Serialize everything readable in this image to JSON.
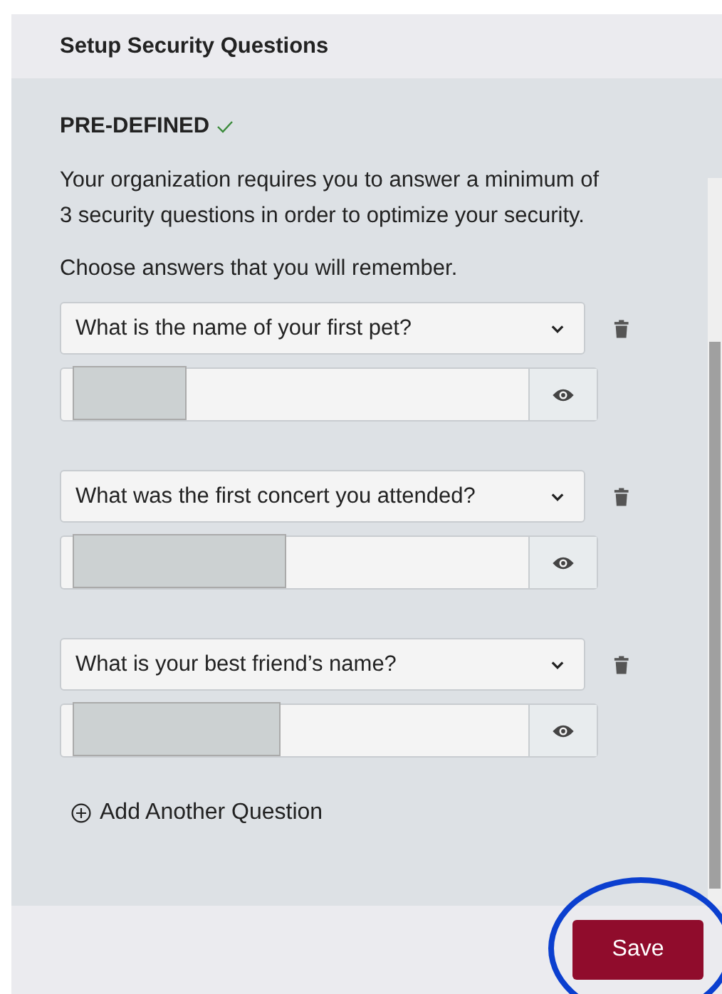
{
  "header": {
    "title": "Setup Security Questions"
  },
  "section": {
    "title": "PRE-DEFINED",
    "complete": true
  },
  "intro": "Your organization requires you to answer a minimum of 3 security questions in order to optimize your security.",
  "hint": "Choose answers that you will remember.",
  "questions": [
    {
      "question": "What is the name of your first pet?"
    },
    {
      "question": "What was the first concert you attended?"
    },
    {
      "question": "What is your best friend’s name?"
    }
  ],
  "add_link": "Add Another Question",
  "save_button": "Save"
}
